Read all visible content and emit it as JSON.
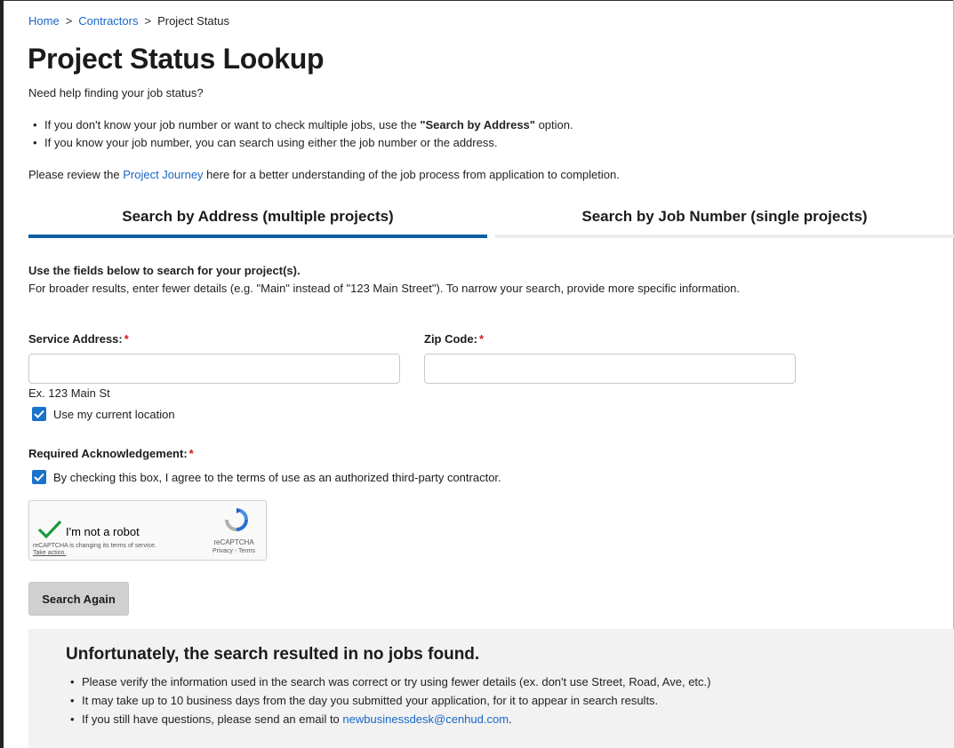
{
  "breadcrumb": {
    "items": [
      "Home",
      "Contractors",
      "Project Status"
    ],
    "separator": ">"
  },
  "page": {
    "title": "Project Status Lookup",
    "help_text": "Need help finding your job status?",
    "bullets": [
      {
        "before": "If you don't know your job number or want to check multiple jobs, use the ",
        "strong": "\"Search by Address\"",
        "after": " option."
      },
      {
        "text": "If you know your job number, you can search using either the job number or the address."
      }
    ],
    "journey": {
      "before": "Please review the ",
      "link": "Project Journey",
      "after": " here for a better understanding of the job process from application to completion."
    }
  },
  "tabs": [
    {
      "label": "Search by Address (multiple projects)",
      "active": true
    },
    {
      "label": "Search by Job Number (single projects)",
      "active": false
    }
  ],
  "form": {
    "instructions_bold": "Use the fields below to search for your project(s).",
    "instructions": "For broader results, enter fewer details (e.g. \"Main\" instead of \"123 Main Street\"). To narrow your search, provide more specific information.",
    "service_address": {
      "label": "Service Address:",
      "required_mark": "*",
      "value": "",
      "hint": "Ex. 123 Main St"
    },
    "zip_code": {
      "label": "Zip Code:",
      "required_mark": "*",
      "value": ""
    },
    "use_location": {
      "label": "Use my current location",
      "checked": true
    },
    "acknowledgement": {
      "label": "Required Acknowledgement:",
      "required_mark": "*",
      "checkbox_label": "By checking this box, I agree to the terms of use as an authorized third-party contractor.",
      "checked": true
    },
    "recaptcha": {
      "label": "I'm not a robot",
      "verified": true,
      "notice": "reCAPTCHA is changing its terms of service.",
      "action": "Take action.",
      "brand": "reCAPTCHA",
      "privacy": "Privacy",
      "terms_sep": " - ",
      "terms": "Terms"
    },
    "search_button": "Search Again"
  },
  "results": {
    "title": "Unfortunately, the search resulted in no jobs found.",
    "items": [
      {
        "text": "Please verify the information used in the search was correct or try using fewer details (ex. don't use Street, Road, Ave, etc.)"
      },
      {
        "text": "It may take up to 10 business days from the day you submitted your application, for it to appear in search results."
      },
      {
        "before": "If you still have questions, please send an email to ",
        "email": "newbusinessdesk@cenhud.com",
        "after": "."
      }
    ]
  },
  "colors": {
    "accent": "#0d5fa3",
    "link": "#1a66c9",
    "required": "#d01c1c",
    "checkbox": "#1a73c9",
    "results_bg": "#f2f2f2"
  }
}
